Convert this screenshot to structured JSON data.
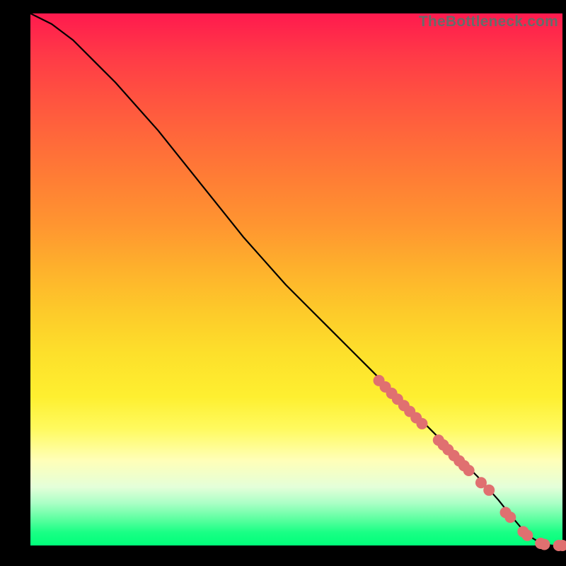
{
  "attribution": "TheBottleneck.com",
  "colors": {
    "dot": "#e07070",
    "line": "#000000"
  },
  "chart_data": {
    "type": "line",
    "title": "",
    "xlabel": "",
    "ylabel": "",
    "xlim": [
      0,
      100
    ],
    "ylim": [
      0,
      100
    ],
    "grid": false,
    "legend": false,
    "series": [
      {
        "name": "curve",
        "x": [
          0,
          4,
          8,
          12,
          16,
          20,
          24,
          28,
          32,
          36,
          40,
          44,
          48,
          52,
          56,
          60,
          64,
          68,
          72,
          76,
          80,
          84,
          88,
          90,
          92,
          94,
          96,
          98,
          100
        ],
        "y": [
          100,
          98,
          95,
          91,
          87,
          82.5,
          78,
          73,
          68,
          63,
          58,
          53.5,
          49,
          45,
          41,
          37,
          33,
          29,
          25,
          21,
          17,
          13,
          8.5,
          6,
          3.6,
          1.6,
          0.4,
          0,
          0
        ]
      }
    ],
    "dots": [
      {
        "x": 65.5,
        "y": 31.0
      },
      {
        "x": 66.7,
        "y": 29.8
      },
      {
        "x": 67.9,
        "y": 28.6
      },
      {
        "x": 69.0,
        "y": 27.5
      },
      {
        "x": 70.2,
        "y": 26.3
      },
      {
        "x": 71.3,
        "y": 25.2
      },
      {
        "x": 72.5,
        "y": 24.0
      },
      {
        "x": 73.6,
        "y": 22.9
      },
      {
        "x": 76.7,
        "y": 19.8
      },
      {
        "x": 77.6,
        "y": 18.9
      },
      {
        "x": 78.5,
        "y": 18.0
      },
      {
        "x": 79.6,
        "y": 16.9
      },
      {
        "x": 80.6,
        "y": 15.9
      },
      {
        "x": 81.5,
        "y": 15.0
      },
      {
        "x": 82.4,
        "y": 14.1
      },
      {
        "x": 84.7,
        "y": 11.8
      },
      {
        "x": 86.2,
        "y": 10.4
      },
      {
        "x": 89.3,
        "y": 6.2
      },
      {
        "x": 90.2,
        "y": 5.3
      },
      {
        "x": 92.6,
        "y": 2.6
      },
      {
        "x": 93.4,
        "y": 1.9
      },
      {
        "x": 95.9,
        "y": 0.4
      },
      {
        "x": 96.6,
        "y": 0.2
      },
      {
        "x": 99.3,
        "y": 0.0
      },
      {
        "x": 100.0,
        "y": 0.0
      }
    ],
    "dot_radius_px": 8
  }
}
